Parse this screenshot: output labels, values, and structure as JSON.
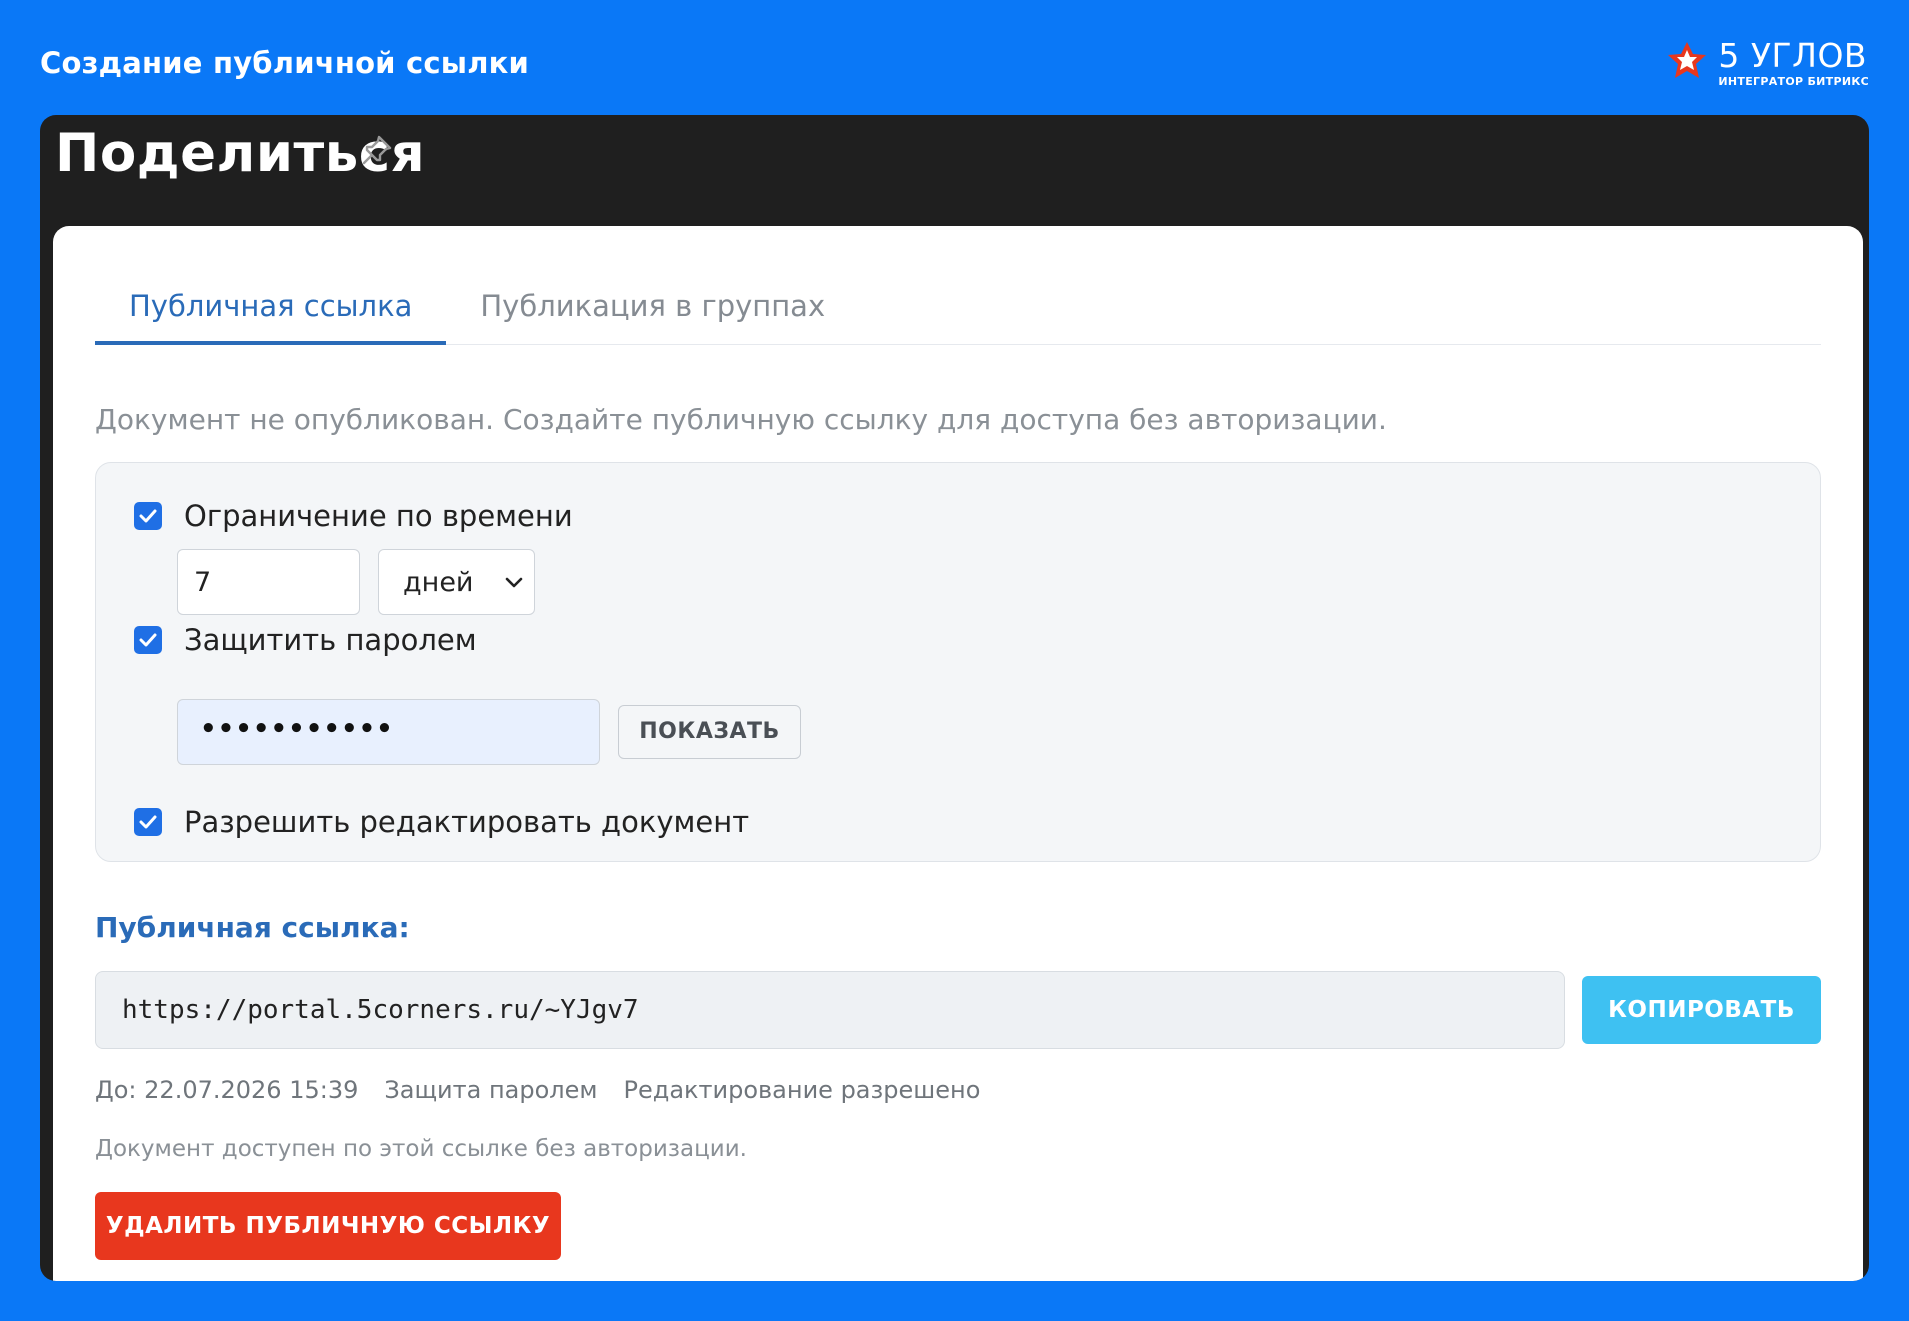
{
  "frame": {
    "title": "Создание публичной ссылки",
    "brand_name": "5 УГЛОВ",
    "brand_subtitle": "ИНТЕГРАТОР БИТРИКС"
  },
  "header": {
    "title": "Поделиться",
    "pin_icon": "pin-icon"
  },
  "tabs": [
    {
      "label": "Публичная ссылка",
      "active": true
    },
    {
      "label": "Публикация в группах",
      "active": false
    }
  ],
  "notice": "Документ не опубликован. Создайте публичную ссылку для доступа без авторизации.",
  "options": {
    "time_limit": {
      "label": "Ограничение по времени",
      "checked": true,
      "value": "7",
      "unit": "дней"
    },
    "password": {
      "label": "Защитить паролем",
      "checked": true,
      "value": "•••••••••••",
      "show_label": "ПОКАЗАТЬ"
    },
    "allow_edit": {
      "label": "Разрешить редактировать документ",
      "checked": true
    }
  },
  "public_link": {
    "heading": "Публичная ссылка:",
    "url": "https://portal.5corners.ru/~YJgv7",
    "copy_label": "КОПИРОВАТЬ",
    "meta": [
      "До: 22.07.2026 15:39",
      "Защита паролем",
      "Редактирование разрешено"
    ],
    "note": "Документ доступен по этой ссылке без авторизации.",
    "delete_label": "УДАЛИТЬ ПУБЛИЧНУЮ ССЫЛКУ"
  },
  "colors": {
    "frame_bg": "#0a78f7",
    "header_bg": "#1f1f1f",
    "accent": "#2a6bb8",
    "checkbox": "#1f6fe5",
    "copy_button": "#3ec1f2",
    "delete_button": "#e8371e"
  }
}
